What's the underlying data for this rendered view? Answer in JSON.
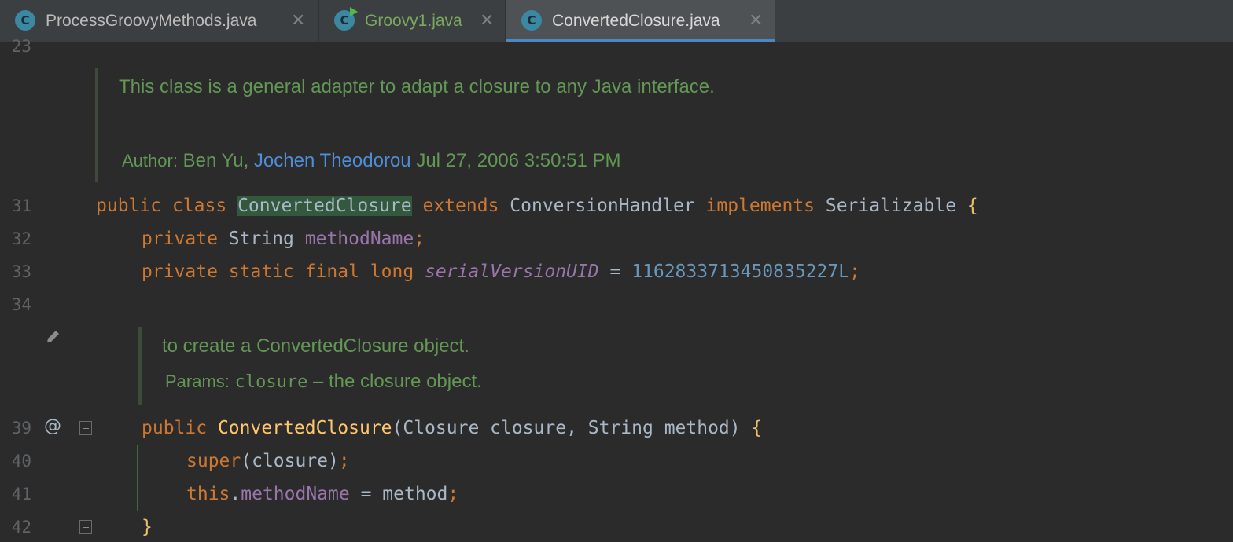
{
  "tabs": [
    {
      "label": "ProcessGroovyMethods.java",
      "icon": "java-class-icon",
      "active": false
    },
    {
      "label": "Groovy1.java",
      "icon": "java-class-runnable-icon",
      "active": false
    },
    {
      "label": "ConvertedClosure.java",
      "icon": "java-class-icon",
      "active": true
    }
  ],
  "tab_icon_letter": "C",
  "close_glyph": "✕",
  "lines": {
    "l23": "23",
    "l31": "31",
    "l32": "32",
    "l33": "33",
    "l34": "34",
    "l39": "39",
    "l40": "40",
    "l41": "41",
    "l42": "42"
  },
  "class_doc": {
    "summary": "This class is a general adapter to adapt a closure to any Java interface.",
    "author_label": "Author:",
    "author_plain": "Ben Yu,",
    "author_link": "Jochen Theodorou",
    "date": "Jul 27, 2006 3:50:51 PM"
  },
  "ctor_doc": {
    "summary": "to create a ConvertedClosure object.",
    "params_label": "Params:",
    "param_name": "closure",
    "param_desc": "– the closure object."
  },
  "code": {
    "l31": {
      "public": "public",
      "class": "class",
      "name": "ConvertedClosure",
      "extends": "extends",
      "parent": "ConversionHandler",
      "implements": "implements",
      "iface": "Serializable",
      "brace": "{"
    },
    "l32": {
      "private": "private",
      "type": "String",
      "field": "methodName",
      "semi": ";"
    },
    "l33": {
      "mods": "private static final long",
      "field": "serialVersionUID",
      "eq": " = ",
      "value": "1162833713450835227L",
      "semi": ";"
    },
    "l39": {
      "public": "public",
      "name": "ConvertedClosure",
      "params": "(Closure closure, String method)",
      "brace": "{"
    },
    "l40": {
      "super": "super",
      "args": "(closure)",
      "semi": ";"
    },
    "l41": {
      "this": "this",
      "dot": ".",
      "field": "methodName",
      "assign": " = method",
      "semi": ";"
    },
    "l42": {
      "brace": "}"
    }
  },
  "gutter": {
    "override_marker": "@",
    "edit_icon": "pencil-icon"
  },
  "colors": {
    "background": "#2b2b2b",
    "keyword": "#cc7832",
    "doc_text": "#629755",
    "link": "#4f8dd6",
    "active_tab_underline": "#4a88c7"
  }
}
